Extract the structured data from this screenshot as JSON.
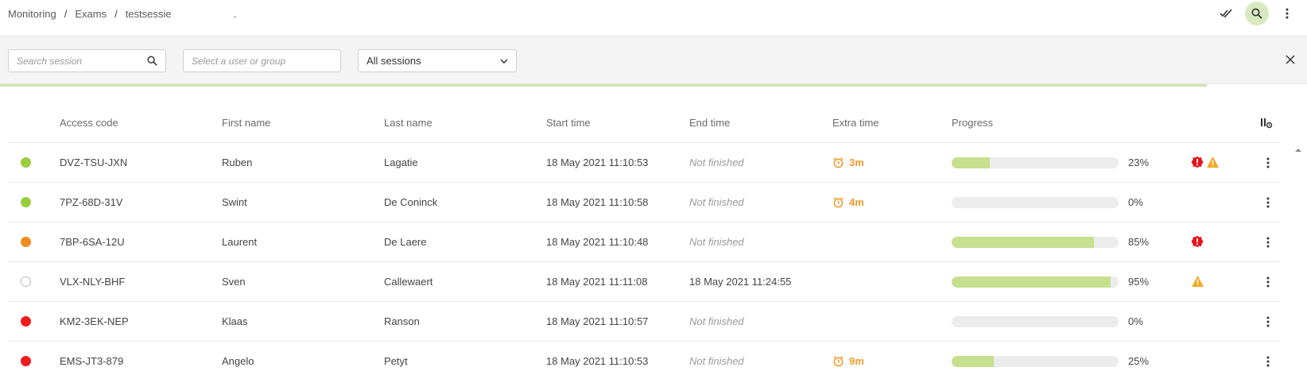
{
  "breadcrumb": [
    "Monitoring",
    "Exams",
    "testsessie"
  ],
  "breadcrumb_separator": "/",
  "breadcrumb_trailing": ".",
  "header_icons": [
    "double-check-icon",
    "search-icon",
    "more-vertical-icon"
  ],
  "filters": {
    "search_placeholder": "Search session",
    "user_placeholder": "Select a user or group",
    "session_select_value": "All sessions"
  },
  "columns": [
    "Access code",
    "First name",
    "Last name",
    "Start time",
    "End time",
    "Extra time",
    "Progress"
  ],
  "colors": {
    "status_green": "#9acd3c",
    "status_orange": "#f28c1c",
    "status_red": "#ee1c1c",
    "status_empty": "#ffffff",
    "extra_time": "#f39a2b",
    "progress_fill": "#c6e08f",
    "flag_red": "#e8101a",
    "flag_orange": "#f5a623",
    "accent_bg": "#d7eac0"
  },
  "rows": [
    {
      "status": "green",
      "code": "DVZ-TSU-JXN",
      "first": "Ruben",
      "last": "Lagatie",
      "start": "18 May 2021 11:10:53",
      "end": "Not finished",
      "end_finished": false,
      "extra": "3m",
      "progress": 23,
      "progress_label": "23%",
      "flags": [
        "error",
        "warning"
      ]
    },
    {
      "status": "green",
      "code": "7PZ-68D-31V",
      "first": "Swint",
      "last": "De Coninck",
      "start": "18 May 2021 11:10:58",
      "end": "Not finished",
      "end_finished": false,
      "extra": "4m",
      "progress": 0,
      "progress_label": "0%",
      "flags": []
    },
    {
      "status": "orange",
      "code": "7BP-6SA-12U",
      "first": "Laurent",
      "last": "De Laere",
      "start": "18 May 2021 11:10:48",
      "end": "Not finished",
      "end_finished": false,
      "extra": "",
      "progress": 85,
      "progress_label": "85%",
      "flags": [
        "error"
      ]
    },
    {
      "status": "empty",
      "code": "VLX-NLY-BHF",
      "first": "Sven",
      "last": "Callewaert",
      "start": "18 May 2021 11:11:08",
      "end": "18 May 2021 11:24:55",
      "end_finished": true,
      "extra": "",
      "progress": 95,
      "progress_label": "95%",
      "flags": [
        "warning"
      ]
    },
    {
      "status": "red",
      "code": "KM2-3EK-NEP",
      "first": "Klaas",
      "last": "Ranson",
      "start": "18 May 2021 11:10:57",
      "end": "Not finished",
      "end_finished": false,
      "extra": "",
      "progress": 0,
      "progress_label": "0%",
      "flags": []
    },
    {
      "status": "red",
      "code": "EMS-JT3-879",
      "first": "Angelo",
      "last": "Petyt",
      "start": "18 May 2021 11:10:53",
      "end": "Not finished",
      "end_finished": false,
      "extra": "9m",
      "progress": 25,
      "progress_label": "25%",
      "flags": []
    }
  ]
}
